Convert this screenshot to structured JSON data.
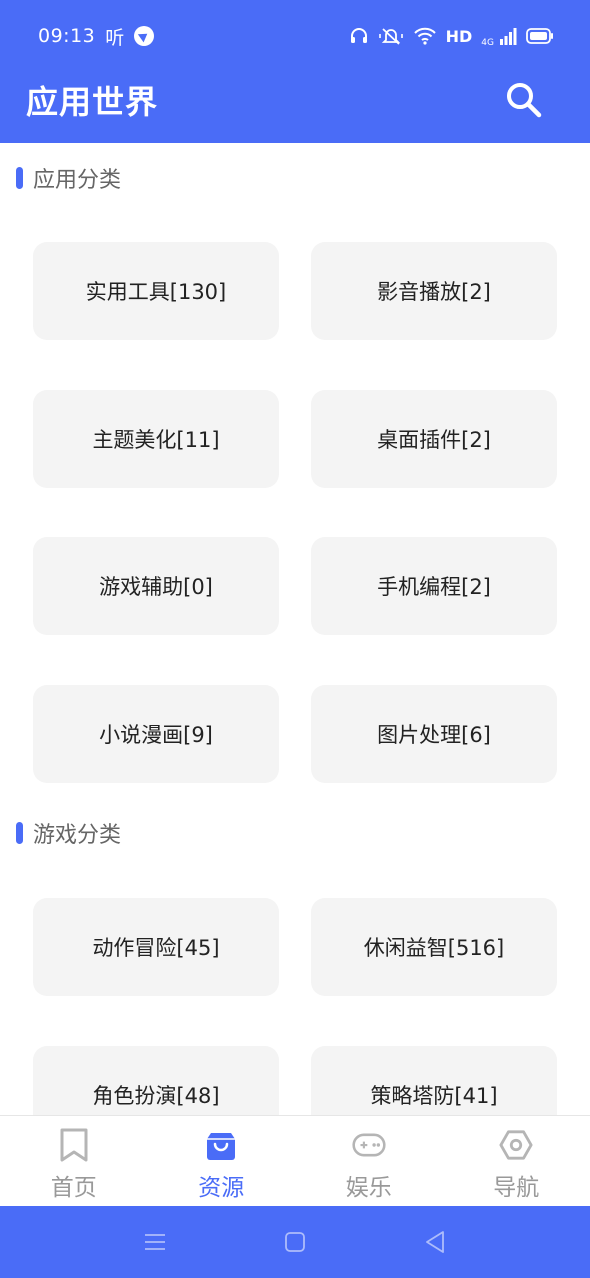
{
  "status_bar": {
    "time": "09:13",
    "listen": "听",
    "hd": "HD",
    "network": "4G"
  },
  "app_bar": {
    "title": "应用世界"
  },
  "sections": [
    {
      "title": "应用分类",
      "items": [
        {
          "label": "实用工具[130]"
        },
        {
          "label": "影音播放[2]"
        },
        {
          "label": "主题美化[11]"
        },
        {
          "label": "桌面插件[2]"
        },
        {
          "label": "游戏辅助[0]"
        },
        {
          "label": "手机编程[2]"
        },
        {
          "label": "小说漫画[9]"
        },
        {
          "label": "图片处理[6]"
        }
      ]
    },
    {
      "title": "游戏分类",
      "items": [
        {
          "label": "动作冒险[45]"
        },
        {
          "label": "休闲益智[516]"
        },
        {
          "label": "角色扮演[48]"
        },
        {
          "label": "策略塔防[41]"
        }
      ]
    }
  ],
  "bottom_nav": {
    "items": [
      {
        "label": "首页",
        "icon": "bookmark-icon",
        "active": false
      },
      {
        "label": "资源",
        "icon": "shopping-bag-icon",
        "active": true
      },
      {
        "label": "娱乐",
        "icon": "gamepad-icon",
        "active": false
      },
      {
        "label": "导航",
        "icon": "hexagon-nut-icon",
        "active": false
      }
    ]
  },
  "colors": {
    "primary": "#4a6cf7",
    "card_bg": "#f4f4f4",
    "inactive": "#999999"
  }
}
